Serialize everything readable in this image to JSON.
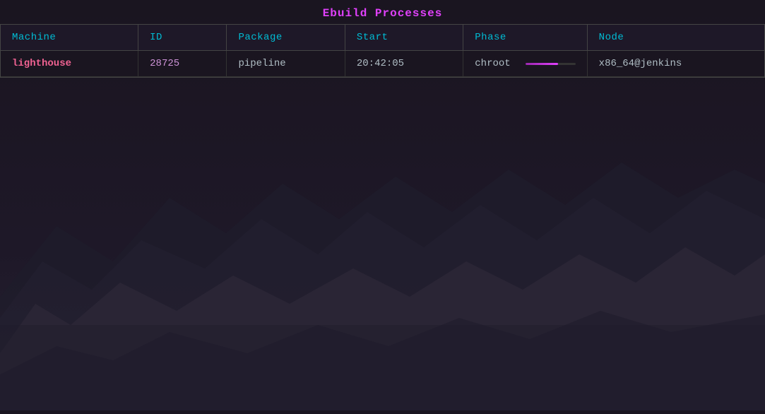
{
  "title": "Ebuild Processes",
  "table": {
    "headers": [
      "Machine",
      "ID",
      "Package",
      "Start",
      "Phase",
      "Node"
    ],
    "rows": [
      {
        "machine": "lighthouse",
        "id": "28725",
        "package": "pipeline",
        "start": "20:42:05",
        "phase": "chroot",
        "progress": 65,
        "node": "x86_64@jenkins"
      }
    ]
  },
  "colors": {
    "title": "#e040fb",
    "header_text": "#00bcd4",
    "machine_text": "#f06292",
    "id_text": "#ce93d8",
    "progress_start": "#9c27b0",
    "progress_end": "#e040fb"
  }
}
